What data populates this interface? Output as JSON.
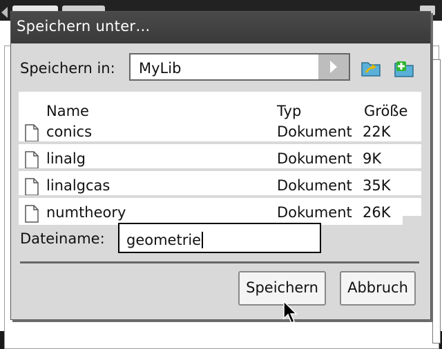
{
  "dialog": {
    "title": "Speichern unter…",
    "save_in_label": "Speichern in:",
    "save_in_value": "MyLib",
    "folder_up_icon": "folder-up-icon",
    "new_folder_icon": "new-folder-icon"
  },
  "file_list": {
    "columns": {
      "name": "Name",
      "type": "Typ",
      "size": "Größe"
    },
    "rows": [
      {
        "name": "conics",
        "type": "Dokument",
        "size": "22K"
      },
      {
        "name": "linalg",
        "type": "Dokument",
        "size": "9K"
      },
      {
        "name": "linalgcas",
        "type": "Dokument",
        "size": "35K"
      },
      {
        "name": "numtheory",
        "type": "Dokument",
        "size": "26K"
      }
    ]
  },
  "filename": {
    "label": "Dateiname:",
    "value": "geometrie"
  },
  "buttons": {
    "save": "Speichern",
    "cancel": "Abbruch"
  },
  "colors": {
    "titlebar": "#3f3f3f",
    "dialog_bg": "#d9d9d9",
    "folder_icon": "#5ab0d8",
    "new_folder_plus": "#2fb52f"
  }
}
